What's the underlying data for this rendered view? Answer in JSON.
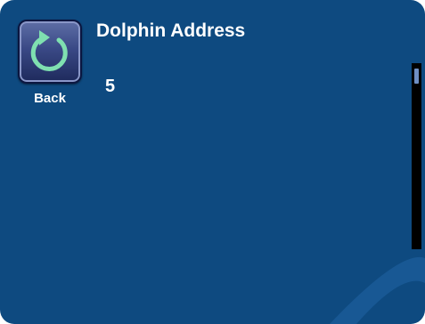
{
  "header": {
    "title": "Dolphin Address"
  },
  "back": {
    "label": "Back",
    "icon": "back-arrow-icon"
  },
  "content": {
    "value": "5"
  },
  "colors": {
    "background": "#0e4a80",
    "text": "#ffffff",
    "icon_arrow": "#7fe0b0",
    "scroll_track": "#000000",
    "scroll_thumb": "#6f8fc4"
  }
}
